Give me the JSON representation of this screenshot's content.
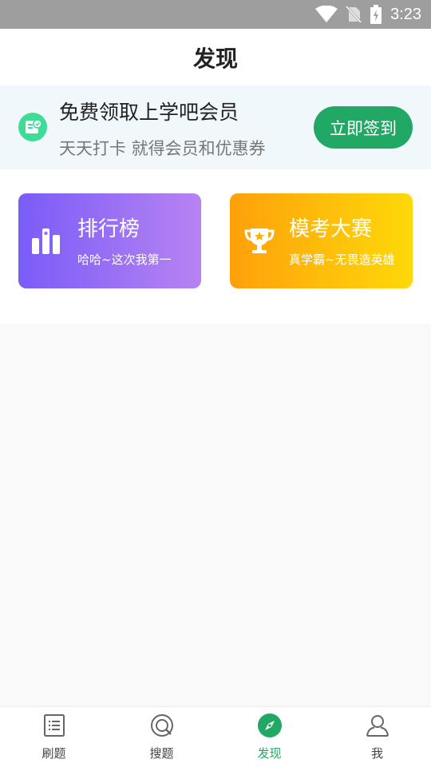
{
  "status_bar": {
    "time": "3:23"
  },
  "header": {
    "title": "发现"
  },
  "promo": {
    "title": "免费领取上学吧会员",
    "subtitle": "天天打卡 就得会员和优惠券",
    "button_label": "立即签到"
  },
  "cards": [
    {
      "title": "排行榜",
      "subtitle": "哈哈~这次我第一",
      "icon": "bar-chart-icon"
    },
    {
      "title": "模考大赛",
      "subtitle": "真学霸~无畏造英雄",
      "icon": "trophy-icon"
    }
  ],
  "nav": {
    "items": [
      {
        "label": "刷题",
        "icon": "list-icon"
      },
      {
        "label": "搜题",
        "icon": "search-icon"
      },
      {
        "label": "发现",
        "icon": "compass-icon",
        "active": true
      },
      {
        "label": "我",
        "icon": "user-icon"
      }
    ]
  },
  "colors": {
    "accent": "#22a865",
    "status_bar": "#9e9e9e",
    "rank_card": "#7a5cf8",
    "exam_card": "#ffa00a"
  }
}
